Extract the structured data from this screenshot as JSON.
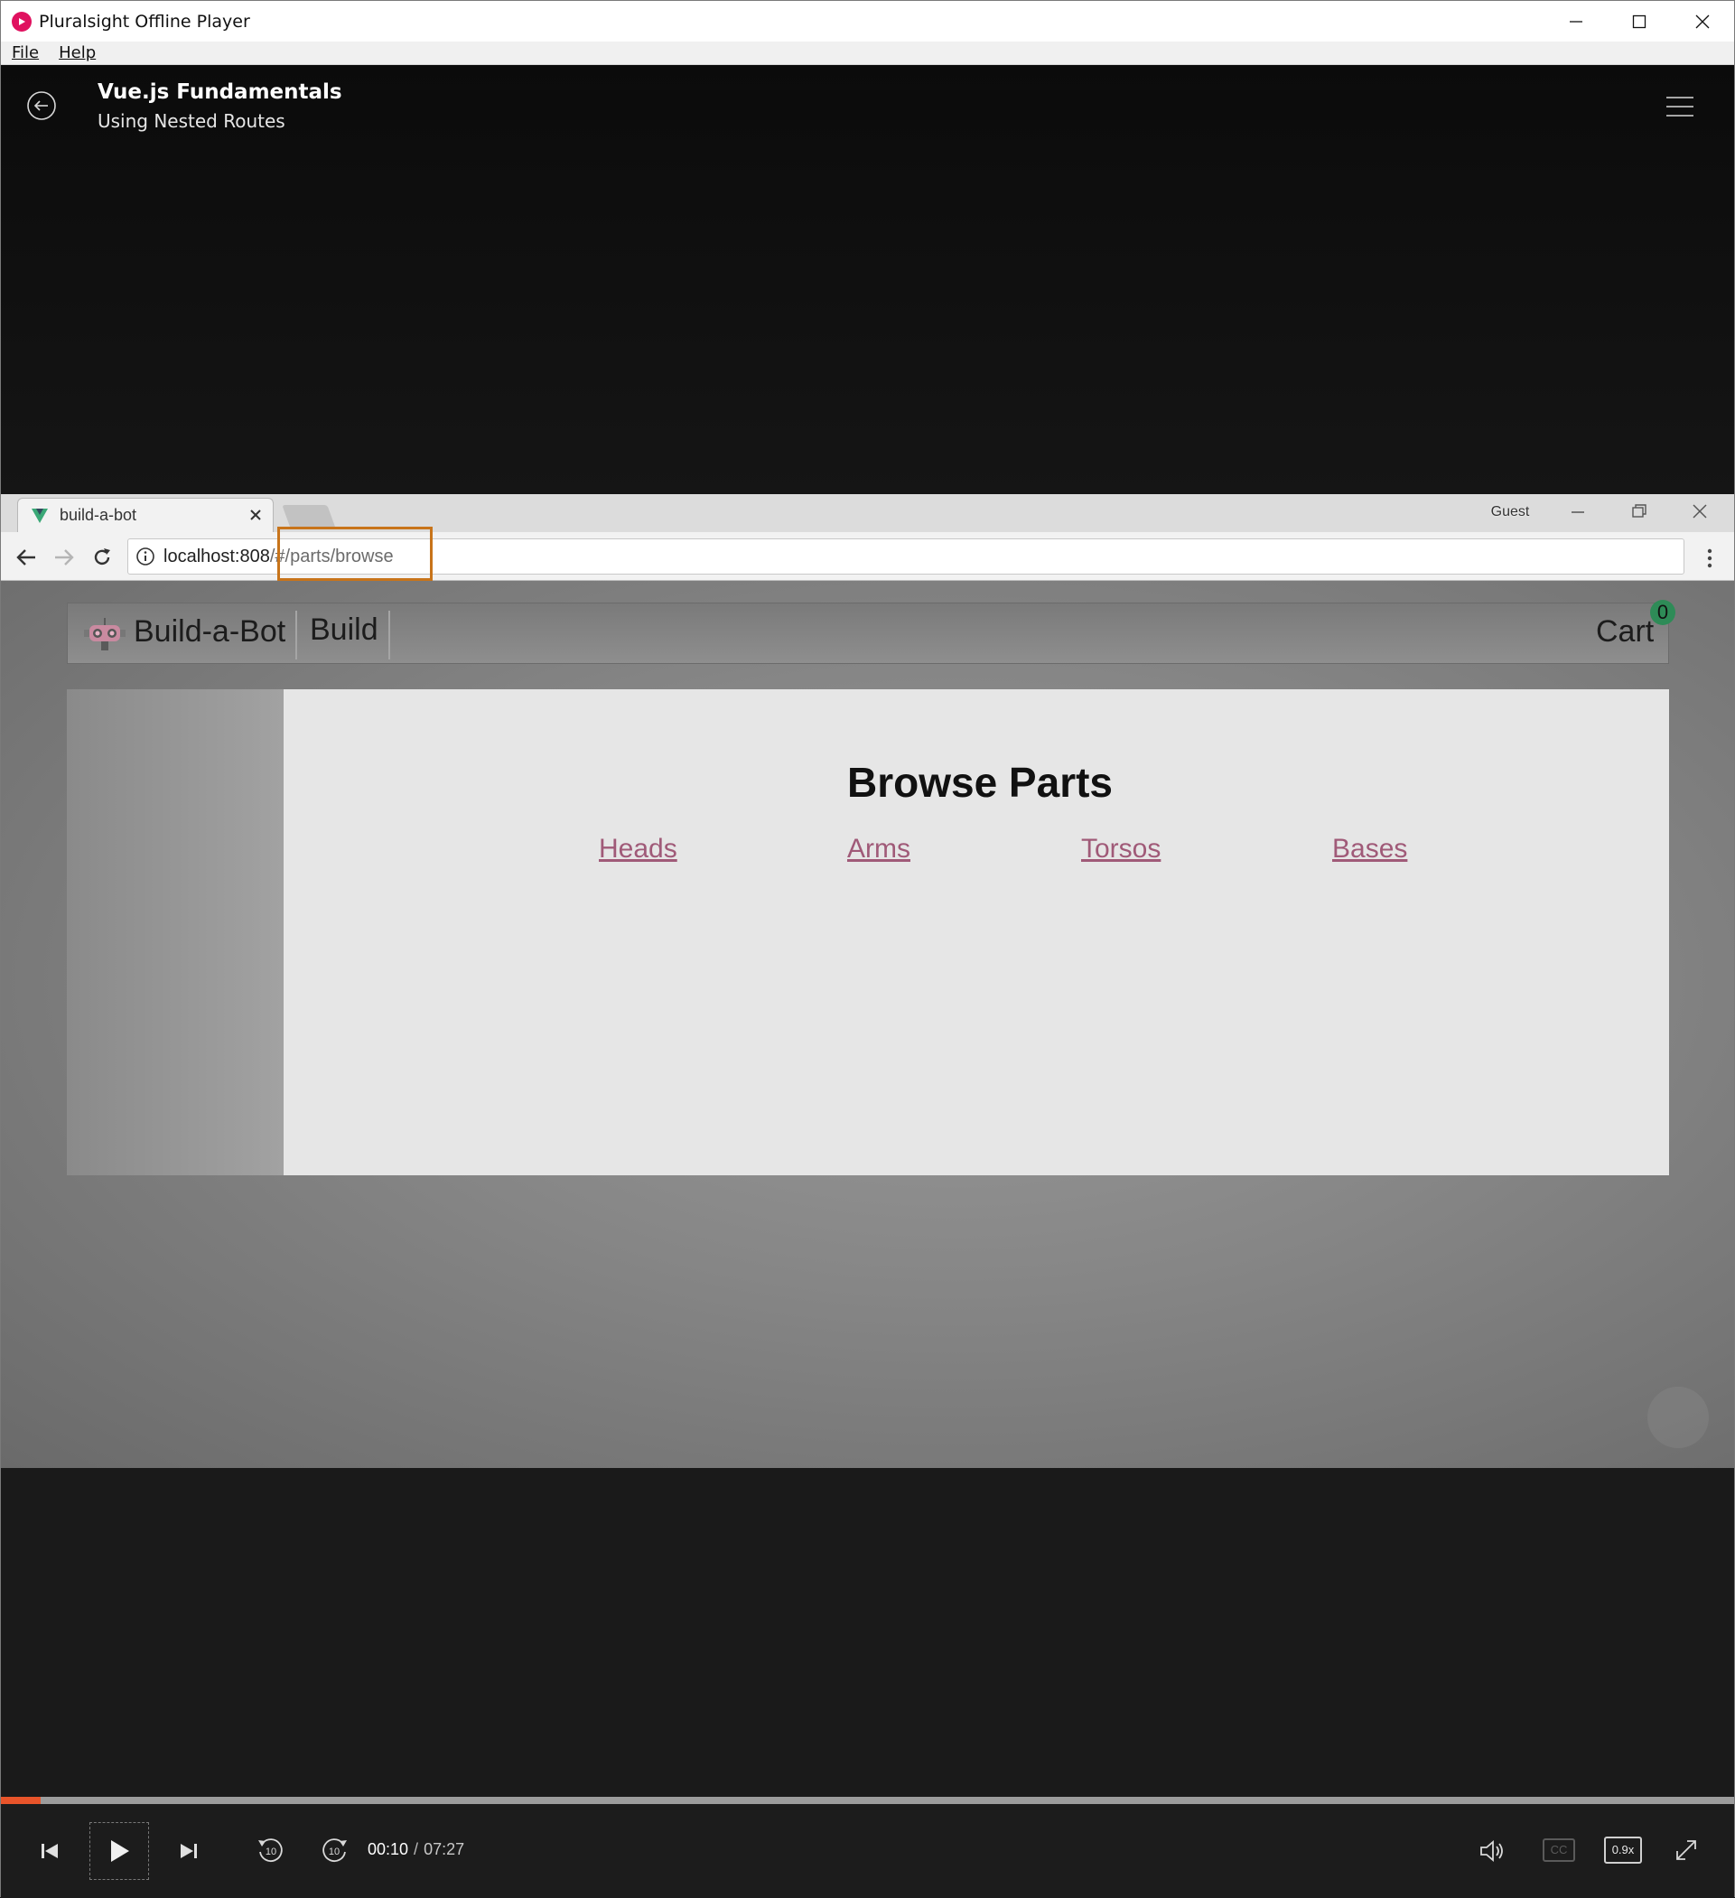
{
  "window": {
    "title": "Pluralsight Offline Player"
  },
  "menu": {
    "file": "File",
    "help": "Help"
  },
  "player": {
    "course_title": "Vue.js Fundamentals",
    "clip_title": "Using Nested Routes"
  },
  "browser": {
    "tab_title": "build-a-bot",
    "profile": "Guest",
    "url_host": "localhost:808",
    "url_path": "/#/parts/browse"
  },
  "site": {
    "brand": "Build-a-Bot",
    "nav_build": "Build",
    "cart_label": "Cart",
    "cart_count": "0",
    "page_heading": "Browse Parts",
    "part_links": [
      "Heads",
      "Arms",
      "Torsos",
      "Bases"
    ]
  },
  "controls": {
    "current_time": "00:10",
    "separator": "/",
    "total_time": "07:27",
    "progress_fraction": 0.023,
    "rewind_seconds": "10",
    "forward_seconds": "10",
    "cc_label": "CC",
    "speed": "0.9x"
  },
  "colors": {
    "accent_progress": "#e8542a",
    "brand_logo": "#e0115f",
    "url_highlight": "#c8741a",
    "link": "#a05a78",
    "cart_badge": "#2e8b57"
  },
  "icons": {
    "back": "back-arrow-circle-icon",
    "menu": "hamburger-icon",
    "favicon": "vue-logo-icon",
    "robot": "robot-head-icon"
  }
}
